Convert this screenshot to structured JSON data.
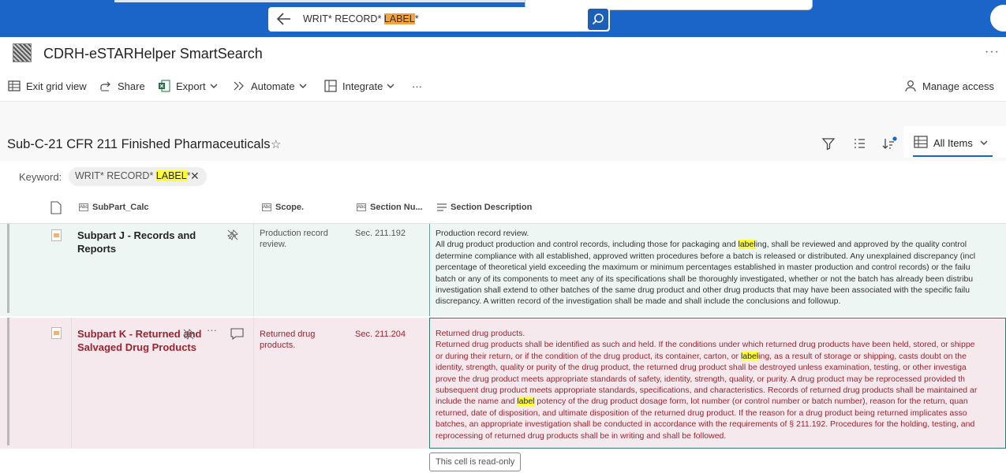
{
  "search": {
    "query_prefix": "WRIT* RECORD* ",
    "query_highlight": "LABEL",
    "query_suffix": "*"
  },
  "app": {
    "title": "CDRH-eSTARHelper SmartSearch",
    "more_icon": "more-horizontal-icon"
  },
  "commands": {
    "exit_grid": "Exit grid view",
    "share": "Share",
    "export": "Export",
    "automate": "Automate",
    "integrate": "Integrate",
    "more": "···",
    "manage_access": "Manage access"
  },
  "view": {
    "title": "Sub-C-21 CFR 211 Finished Pharmaceuticals",
    "view_name": "All Items"
  },
  "keyword": {
    "label": "Keyword:",
    "chip_prefix": "WRIT* RECORD* ",
    "chip_highlight": "LABEL",
    "chip_suffix": "*"
  },
  "columns": [
    "SubPart_Calc",
    "Scope.",
    "Section Nu...",
    "Section Description"
  ],
  "rows": [
    {
      "subpart": "Subpart J - Records and Reports",
      "scope": "Production record review.",
      "section": "Sec. 211.192",
      "desc_title": "Production record review.",
      "desc_lines": [
        [
          "All drug product production and control records, including those for packaging and ",
          "label",
          "ing, shall be reviewed and approved by the quality control"
        ],
        [
          "determine compliance with all established, approved written procedures before a batch is released or distributed. Any unexplained discrepancy (incl"
        ],
        [
          "percentage of theoretical yield exceeding the maximum or minimum percentages established in master production and control records) or the failu"
        ],
        [
          "batch or any of its components to meet any of its specifications shall be thoroughly investigated, whether or not the batch has already been distribu"
        ],
        [
          "investigation shall extend to other batches of the same drug product and other drug products that may have been associated with the specific failu"
        ],
        [
          "discrepancy. A written record of the investigation shall be made and shall include the conclusions and followup."
        ]
      ]
    },
    {
      "subpart": "Subpart K - Returned and Salvaged Drug Products",
      "scope": "Returned drug products.",
      "section": "Sec. 211.204",
      "desc_title": "Returned drug products.",
      "desc_lines": [
        [
          "Returned drug products shall be identified as such and held. If the conditions under which returned drug products have been held, stored, or shippe"
        ],
        [
          "or during their return, or if the condition of the drug product, its container, carton, or ",
          "label",
          "ing, as a result of storage or shipping, casts doubt on the"
        ],
        [
          "identity, strength, quality or purity of the drug product, the returned drug product shall be destroyed unless examination, testing, or other investiga"
        ],
        [
          "prove the drug product meets appropriate standards of safety, identity, strength, quality, or purity. A drug product may be reprocessed provided th"
        ],
        [
          "subsequent drug product meets appropriate standards, specifications, and characteristics. Records of returned drug products shall be maintained ar"
        ],
        [
          "include the name and ",
          "label",
          " potency of the drug product dosage form, lot number (or control number or batch number), reason for the return, quan"
        ],
        [
          "returned, date of disposition, and ultimate disposition of the returned drug product. If the reason for a drug product being returned implicates asso"
        ],
        [
          "batches, an appropriate investigation shall be conducted in accordance with the requirements of § 211.192. Procedures for the holding, testing, and"
        ],
        [
          "reprocessing of returned drug products shall be in writing and shall be followed."
        ]
      ]
    }
  ],
  "tooltip": "This cell is read-only"
}
